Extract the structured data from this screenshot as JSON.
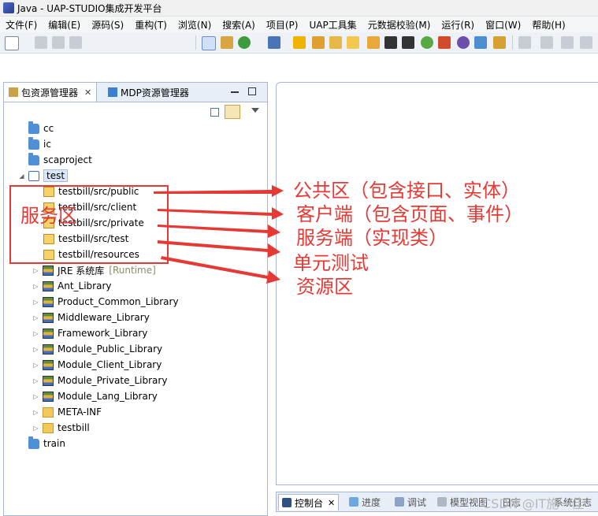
{
  "window": {
    "title": "Java - UAP-STUDIO集成开发平台"
  },
  "menu": [
    "文件(F)",
    "编辑(E)",
    "源码(S)",
    "重构(T)",
    "浏览(N)",
    "搜索(A)",
    "项目(P)",
    "UAP工具集",
    "元数据校验(M)",
    "运行(R)",
    "窗口(W)",
    "帮助(H)"
  ],
  "left_view": {
    "tab_active": "包资源管理器",
    "tab_close": "✕",
    "tab_other": "MDP资源管理器"
  },
  "tree": {
    "cc": "cc",
    "ic": "ic",
    "scaproject": "scaproject",
    "test": "test",
    "pkg_public": "testbill/src/public",
    "pkg_client": "testbill/src/client",
    "pkg_private": "testbill/src/private",
    "pkg_test": "testbill/src/test",
    "pkg_resources": "testbill/resources",
    "jre": "JRE 系统库",
    "jre_tag": "[Runtime]",
    "ant": "Ant_Library",
    "product_common": "Product_Common_Library",
    "middleware": "Middleware_Library",
    "framework": "Framework_Library",
    "module_public": "Module_Public_Library",
    "module_client": "Module_Client_Library",
    "module_private": "Module_Private_Library",
    "module_lang": "Module_Lang_Library",
    "meta_inf": "META-INF",
    "testbill": "testbill",
    "train": "train"
  },
  "bottom_tabs": {
    "console": "控制台",
    "console_close": "✕",
    "progress": "进度",
    "debug": "调试",
    "model_view": "模型视图",
    "d": "日志",
    "e": "系统日志"
  },
  "annotations": {
    "box_label": "服务区",
    "public": "公共区（包含接口、实体）",
    "client": "客户端（包含页面、事件）",
    "private": "服务端（实现类）",
    "test": "单元测试",
    "resources": "资源区"
  },
  "watermark": "CSDN @IT施一佳",
  "colors": {
    "annotation_red": "#e53935",
    "view_border": "#a9b7cc"
  }
}
